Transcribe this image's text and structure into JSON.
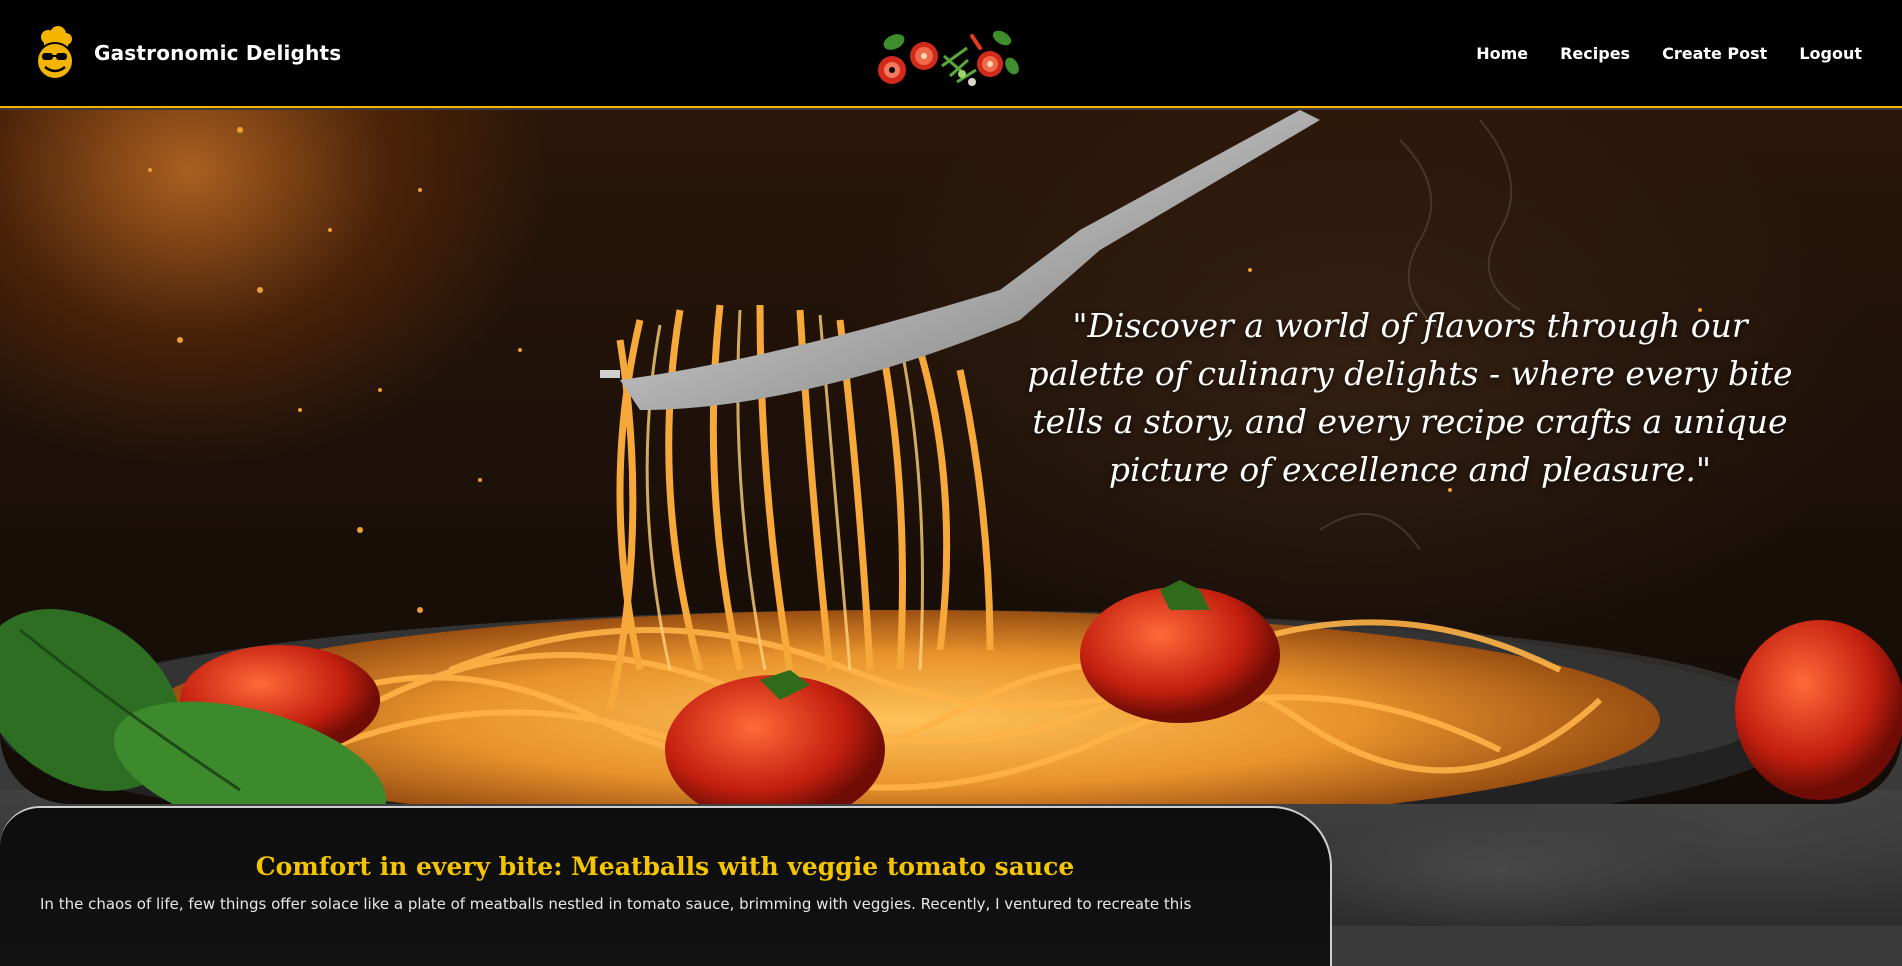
{
  "navbar": {
    "brand_name": "Gastronomic Delights",
    "links": [
      {
        "label": "Home"
      },
      {
        "label": "Recipes"
      },
      {
        "label": "Create Post"
      },
      {
        "label": "Logout"
      }
    ]
  },
  "hero": {
    "quote": "\"Discover a world of flavors through our palette of culinary delights - where every bite tells a story, and every recipe crafts a unique picture of excellence and pleasure.\""
  },
  "post": {
    "title": "Comfort in every bite: Meatballs with veggie tomato sauce",
    "excerpt": "In the chaos of life, few things offer solace like a plate of meatballs nestled in tomato sauce, brimming with veggies. Recently, I ventured to recreate this"
  },
  "colors": {
    "accent": "#f5b400",
    "navbar_bg": "#000000",
    "title_yellow": "#f5c400"
  }
}
